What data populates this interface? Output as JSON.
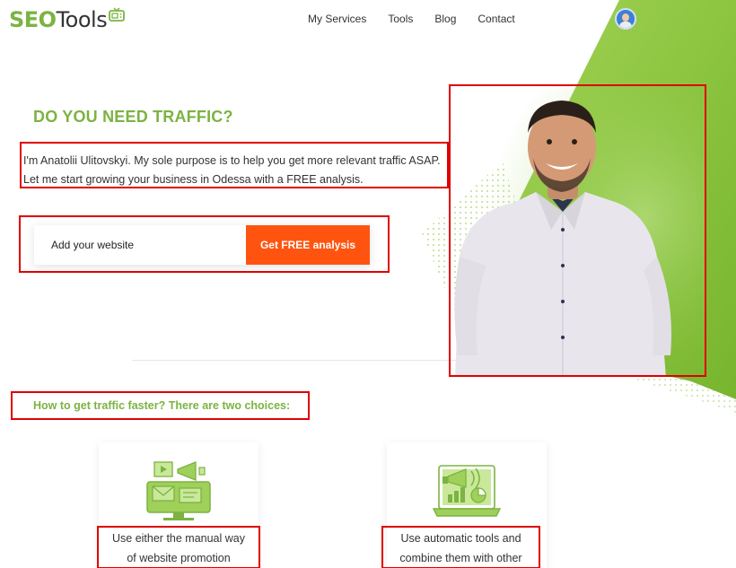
{
  "header": {
    "logo": {
      "part1": "SEO",
      "part2": "Tools"
    },
    "nav": [
      "My Services",
      "Tools",
      "Blog",
      "Contact"
    ]
  },
  "hero": {
    "title": "DO YOU NEED TRAFFIC?",
    "line1": "I'm Anatolii Ulitovskyi. My sole purpose is to help you get more relevant traffic ASAP.",
    "line2": "Let me start growing your business in Odessa with a FREE analysis.",
    "input_placeholder": "Add your website",
    "button_label": "Get FREE analysis"
  },
  "choices": {
    "title": "How to get traffic faster? There are two choices:",
    "cards": [
      {
        "icon": "media-marketing-icon",
        "line1": "Use either the manual way",
        "line2": "of website promotion"
      },
      {
        "icon": "analytics-laptop-icon",
        "line1": "Use automatic tools and",
        "line2": "combine them with other"
      }
    ]
  },
  "colors": {
    "brand_green": "#7cb342",
    "cta_orange": "#ff5410",
    "annotation_red": "#e00000"
  }
}
